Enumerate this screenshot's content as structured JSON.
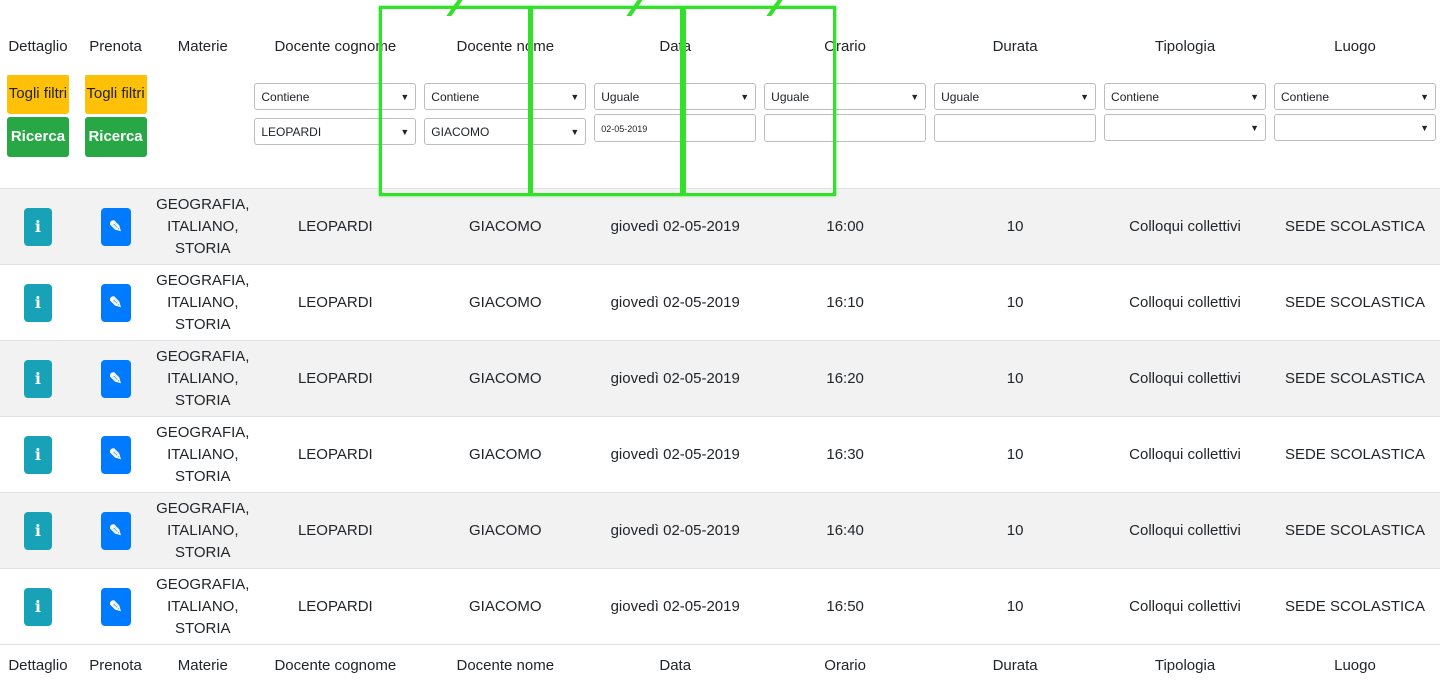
{
  "columns": [
    "Dettaglio",
    "Prenota",
    "Materie",
    "Docente cognome",
    "Docente nome",
    "Data",
    "Orario",
    "Durata",
    "Tipologia",
    "Luogo"
  ],
  "filter_buttons": {
    "clear_label": "Togli filtri",
    "search_label": "Ricerca"
  },
  "filters": {
    "docente_cognome": {
      "mode": "Contiene",
      "value": "LEOPARDI"
    },
    "docente_nome": {
      "mode": "Contiene",
      "value": "GIACOMO"
    },
    "data": {
      "mode": "Uguale",
      "value": "02-05-2019"
    },
    "orario": {
      "mode": "Uguale",
      "value": ""
    },
    "durata": {
      "mode": "Uguale",
      "value": ""
    },
    "tipologia": {
      "mode": "Contiene",
      "value": ""
    },
    "luogo": {
      "mode": "Contiene",
      "value": ""
    }
  },
  "icons": {
    "info": "info-icon",
    "edit": "edit-icon"
  },
  "rows": [
    {
      "materie": "GEOGRAFIA, ITALIANO, STORIA",
      "cognome": "LEOPARDI",
      "nome": "GIACOMO",
      "data": "giovedì 02-05-2019",
      "orario": "16:00",
      "durata": "10",
      "tipologia": "Colloqui collettivi",
      "luogo": "SEDE SCOLASTICA"
    },
    {
      "materie": "GEOGRAFIA, ITALIANO, STORIA",
      "cognome": "LEOPARDI",
      "nome": "GIACOMO",
      "data": "giovedì 02-05-2019",
      "orario": "16:10",
      "durata": "10",
      "tipologia": "Colloqui collettivi",
      "luogo": "SEDE SCOLASTICA"
    },
    {
      "materie": "GEOGRAFIA, ITALIANO, STORIA",
      "cognome": "LEOPARDI",
      "nome": "GIACOMO",
      "data": "giovedì 02-05-2019",
      "orario": "16:20",
      "durata": "10",
      "tipologia": "Colloqui collettivi",
      "luogo": "SEDE SCOLASTICA"
    },
    {
      "materie": "GEOGRAFIA, ITALIANO, STORIA",
      "cognome": "LEOPARDI",
      "nome": "GIACOMO",
      "data": "giovedì 02-05-2019",
      "orario": "16:30",
      "durata": "10",
      "tipologia": "Colloqui collettivi",
      "luogo": "SEDE SCOLASTICA"
    },
    {
      "materie": "GEOGRAFIA, ITALIANO, STORIA",
      "cognome": "LEOPARDI",
      "nome": "GIACOMO",
      "data": "giovedì 02-05-2019",
      "orario": "16:40",
      "durata": "10",
      "tipologia": "Colloqui collettivi",
      "luogo": "SEDE SCOLASTICA"
    },
    {
      "materie": "GEOGRAFIA, ITALIANO, STORIA",
      "cognome": "LEOPARDI",
      "nome": "GIACOMO",
      "data": "giovedì 02-05-2019",
      "orario": "16:50",
      "durata": "10",
      "tipologia": "Colloqui collettivi",
      "luogo": "SEDE SCOLASTICA"
    }
  ],
  "colors": {
    "highlight": "#33e02a",
    "warning": "#ffc107",
    "success": "#28a745",
    "info": "#17a2b8",
    "primary": "#007bff"
  }
}
